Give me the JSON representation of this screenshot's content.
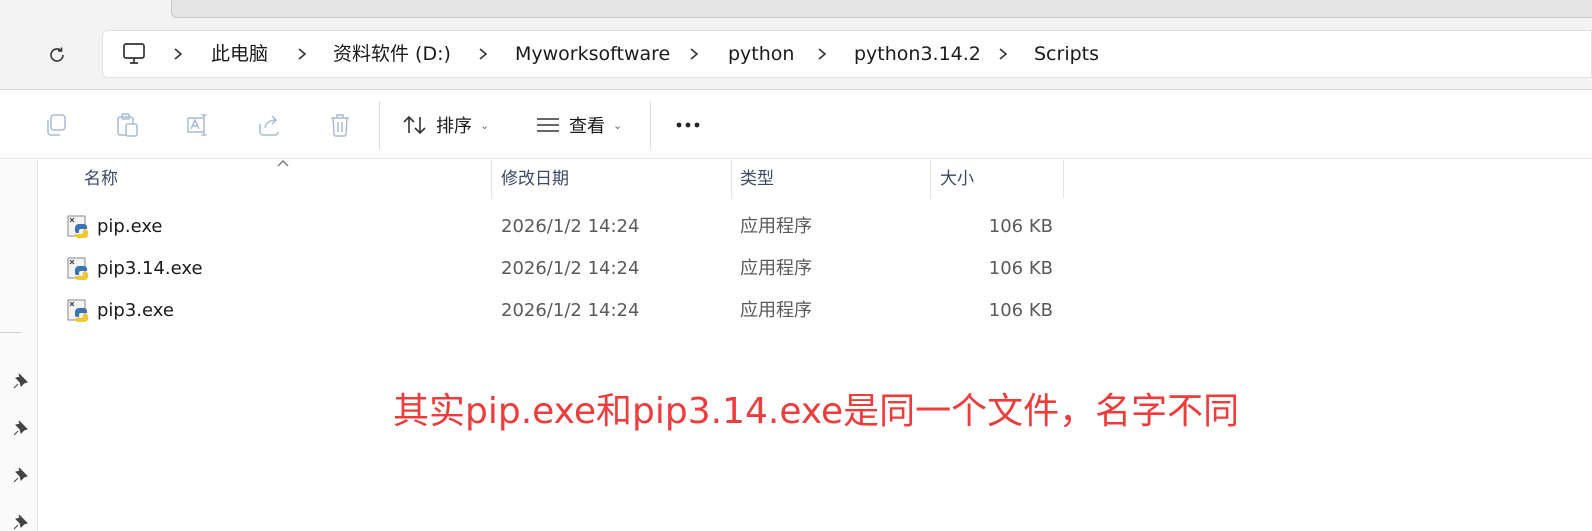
{
  "breadcrumb": {
    "items": [
      "此电脑",
      "资料软件 (D:)",
      "Myworksoftware",
      "python",
      "python3.14.2",
      "Scripts"
    ]
  },
  "toolbar": {
    "sort_label": "排序",
    "view_label": "查看"
  },
  "columns": {
    "name": "名称",
    "date": "修改日期",
    "type": "类型",
    "size": "大小"
  },
  "files": [
    {
      "name": "pip.exe",
      "date": "2026/1/2 14:24",
      "type": "应用程序",
      "size": "106 KB"
    },
    {
      "name": "pip3.14.exe",
      "date": "2026/1/2 14:24",
      "type": "应用程序",
      "size": "106 KB"
    },
    {
      "name": "pip3.exe",
      "date": "2026/1/2 14:24",
      "type": "应用程序",
      "size": "106 KB"
    }
  ],
  "annotation": "其实pip.exe和pip3.14.exe是同一个文件，名字不同",
  "colors": {
    "annotation": "#ee3b3b",
    "header_text": "#3b4a66",
    "toolbar_disabled_icon": "#9fb2cc"
  }
}
